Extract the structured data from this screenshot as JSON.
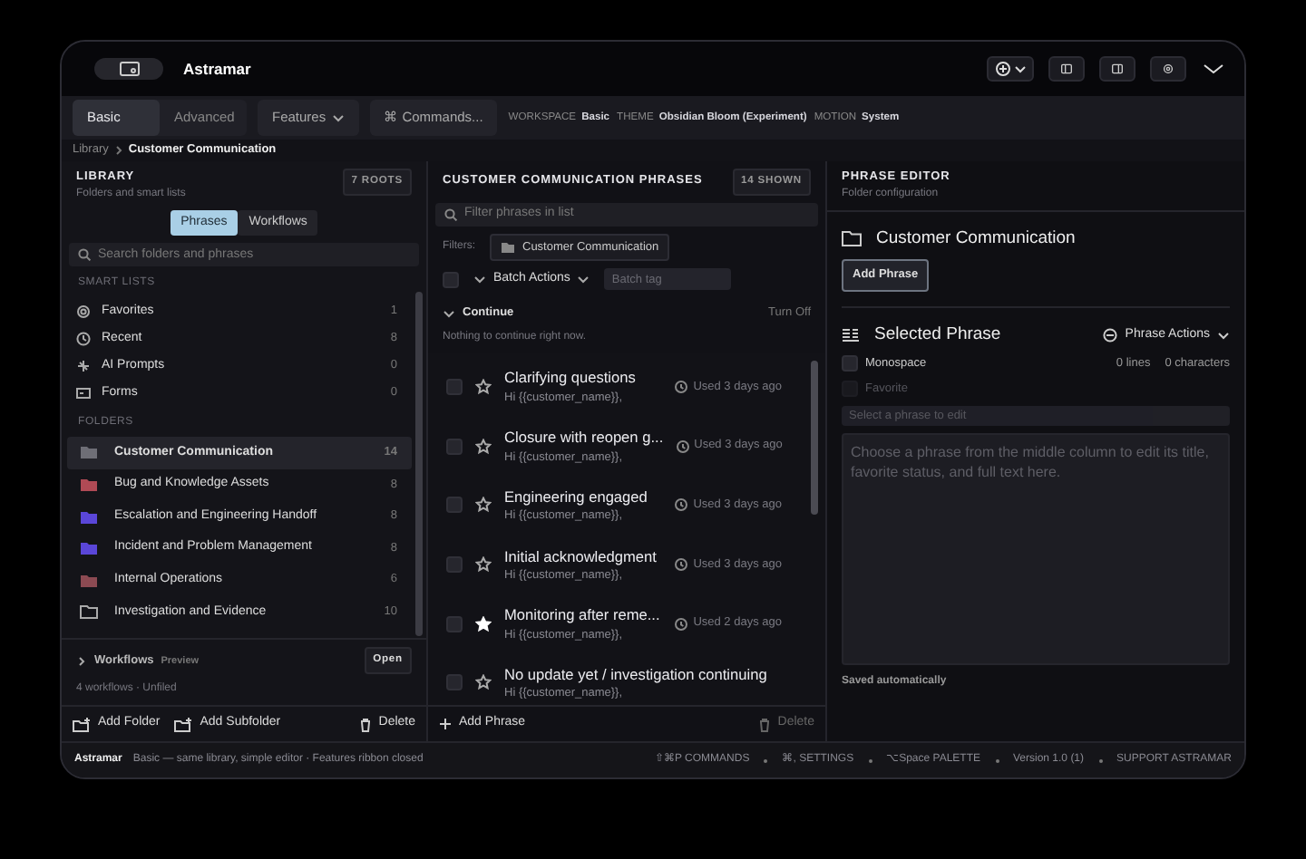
{
  "window": {
    "app_name": "Astramar"
  },
  "ribbon": {
    "mode_tabs": [
      {
        "label": "Basic",
        "selected": true
      },
      {
        "label": "Advanced",
        "selected": false
      }
    ],
    "features_button": "Features",
    "commands_button": "⌘ Commands...",
    "settings": [
      {
        "label": "WORKSPACE",
        "value": "Basic"
      },
      {
        "label": "THEME",
        "value": "Obsidian Bloom (Experiment)"
      },
      {
        "label": "MOTION",
        "value": "System"
      }
    ]
  },
  "breadcrumb": [
    "Library",
    "Customer Communication"
  ],
  "library": {
    "title": "LIBRARY",
    "subtitle": "Folders and smart lists",
    "roots_badge": "7 ROOTS",
    "tabs": [
      {
        "label": "Phrases",
        "selected": true
      },
      {
        "label": "Workflows",
        "selected": false
      }
    ],
    "search": {
      "placeholder": "Search folders and phrases"
    },
    "smart_lists_heading": "SMART LISTS",
    "smart_lists": [
      {
        "kind": "favorites",
        "label": "Favorites",
        "count": "1"
      },
      {
        "kind": "recent",
        "label": "Recent",
        "count": "8"
      },
      {
        "kind": "ai",
        "label": "AI Prompts",
        "count": "0"
      },
      {
        "kind": "forms",
        "label": "Forms",
        "count": "0"
      }
    ],
    "folders_heading": "FOLDERS",
    "folders": [
      {
        "label": "Customer Communication",
        "count": "14",
        "selected": true,
        "kind": "filled",
        "color": "#6e6e76"
      },
      {
        "label": "Bug and Knowledge Assets",
        "count": "8",
        "selected": false,
        "kind": "filled",
        "color": "#b04a55"
      },
      {
        "label": "Escalation and Engineering Handoff",
        "count": "8",
        "selected": false,
        "kind": "filled",
        "color": "#5a46d8"
      },
      {
        "label": "Incident and Problem Management",
        "count": "8",
        "selected": false,
        "kind": "filled",
        "color": "#5a46d8"
      },
      {
        "label": "Internal Operations",
        "count": "6",
        "selected": false,
        "kind": "filled",
        "color": "#8c4a52"
      },
      {
        "label": "Investigation and Evidence",
        "count": "10",
        "selected": false,
        "kind": "outline"
      }
    ],
    "workflows": {
      "label": "Workflows",
      "tag": "Preview",
      "open_button": "Open",
      "summary": "4 workflows · Unfiled",
      "expanded": false
    },
    "footer": {
      "add_folder": "Add Folder",
      "add_subfolder": "Add Subfolder",
      "delete": "Delete"
    }
  },
  "phrases": {
    "title": "CUSTOMER COMMUNICATION PHRASES",
    "shown_badge": "14 SHOWN",
    "search": {
      "placeholder": "Filter phrases in list"
    },
    "filters_label": "Filters:",
    "filter_chip": "Customer Communication",
    "select_all_checked": false,
    "batch_actions": "Batch Actions",
    "batch_tag": {
      "placeholder": "Batch tag"
    },
    "continue": {
      "label": "Continue",
      "expanded": true,
      "turn_off": "Turn Off",
      "empty_text": "Nothing to continue right now."
    },
    "items": [
      {
        "title": "Clarifying questions",
        "preview": "Hi {{customer_name}},",
        "used": "Used 3 days ago",
        "favorite": false,
        "checked": false
      },
      {
        "title": "Closure with reopen g...",
        "preview": "Hi {{customer_name}},",
        "used": "Used 3 days ago",
        "favorite": false,
        "checked": false
      },
      {
        "title": "Engineering engaged",
        "preview": "Hi {{customer_name}},",
        "used": "Used 3 days ago",
        "favorite": false,
        "checked": false
      },
      {
        "title": "Initial acknowledgment",
        "preview": "Hi {{customer_name}},",
        "used": "Used 3 days ago",
        "favorite": false,
        "checked": false
      },
      {
        "title": "Monitoring after reme...",
        "preview": "Hi {{customer_name}},",
        "used": "Used 2 days ago",
        "favorite": true,
        "checked": false
      },
      {
        "title": "No update yet / investigation continuing",
        "preview": "Hi {{customer_name}},",
        "favorite": false,
        "checked": false
      }
    ],
    "footer": {
      "add_phrase": "Add Phrase",
      "delete": "Delete",
      "delete_disabled": true
    }
  },
  "editor": {
    "title": "PHRASE EDITOR",
    "subtitle": "Folder configuration",
    "folder_name": "Customer Communication",
    "add_phrase": "Add Phrase",
    "selected_title": "Selected Phrase",
    "actions": "Phrase Actions",
    "monospace": {
      "label": "Monospace",
      "checked": false,
      "disabled": false
    },
    "stats": [
      "0 lines",
      "0 characters"
    ],
    "favorite": {
      "label": "Favorite",
      "checked": false,
      "disabled": true
    },
    "title_field": {
      "placeholder": "Select a phrase to edit",
      "disabled": true
    },
    "body_field": {
      "placeholder": "Choose a phrase from the middle column to edit its title, favorite status, and full text here."
    },
    "save_status": "Saved automatically"
  },
  "status_bar": {
    "app_name": "Astramar",
    "message": "Basic — same library, simple editor · Features ribbon closed",
    "items": [
      "⇧⌘P COMMANDS",
      "⌘, SETTINGS",
      "⌥Space PALETTE",
      "Version 1.0 (1)",
      "SUPPORT ASTRAMAR"
    ]
  }
}
